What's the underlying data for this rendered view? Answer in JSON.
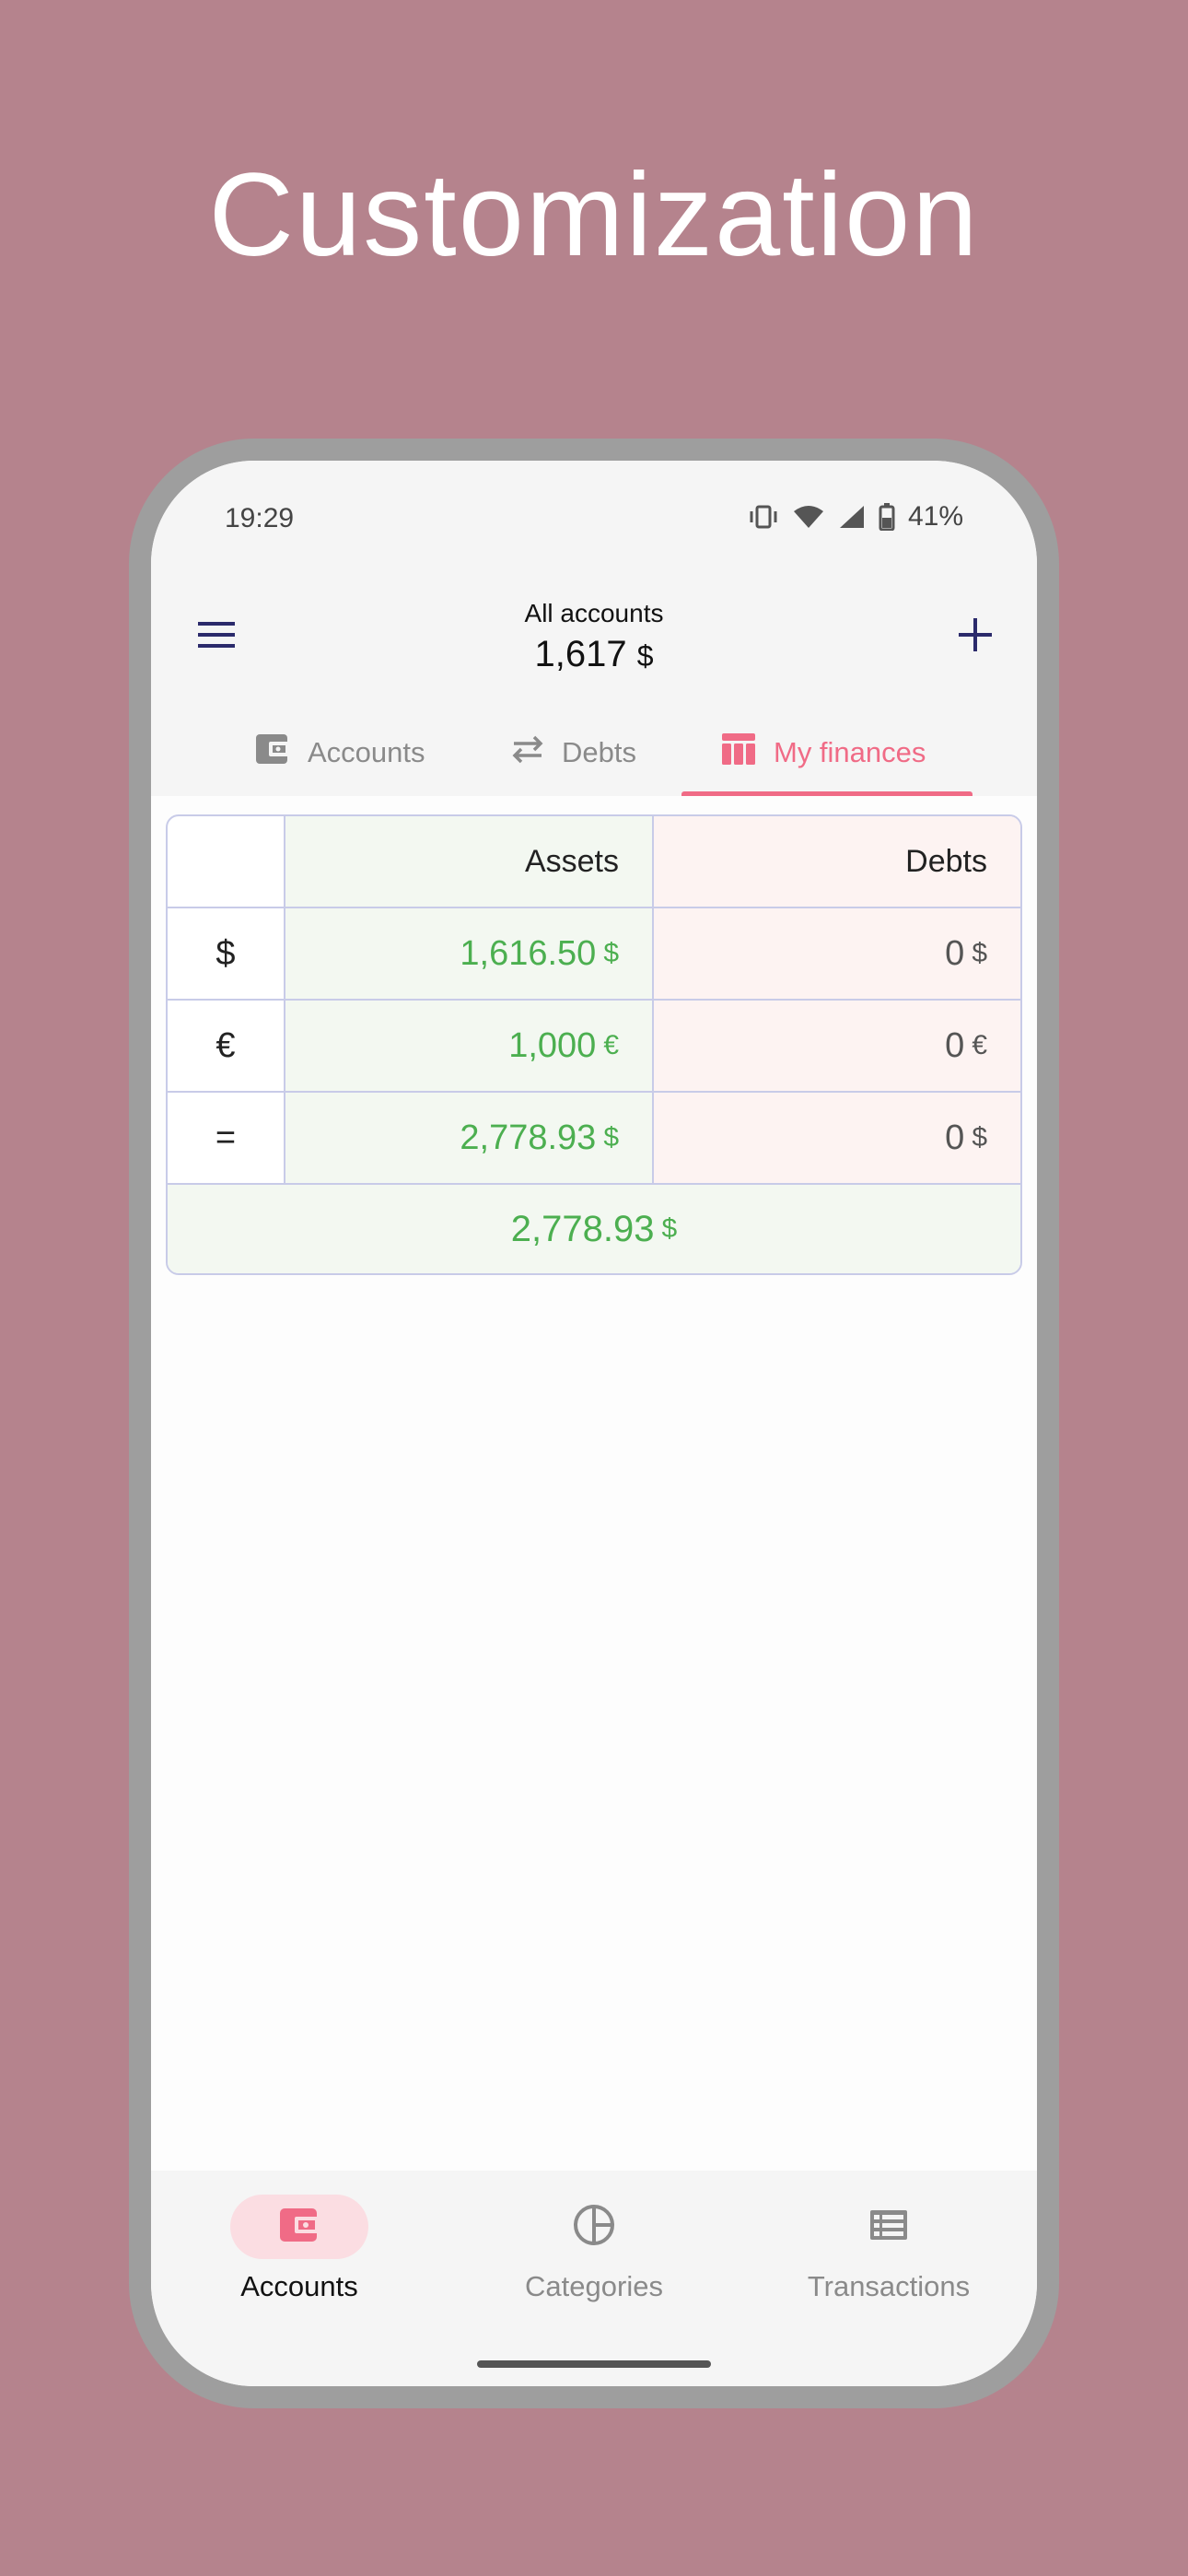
{
  "promo": {
    "title": "Customization"
  },
  "status_bar": {
    "time": "19:29",
    "battery": "41%"
  },
  "app_bar": {
    "title": "All accounts",
    "amount": "1,617",
    "currency": "$"
  },
  "tabs": [
    {
      "label": "Accounts",
      "icon": "wallet-icon",
      "active": false
    },
    {
      "label": "Debts",
      "icon": "swap-arrows-icon",
      "active": false
    },
    {
      "label": "My finances",
      "icon": "table-icon",
      "active": true
    }
  ],
  "finances_table": {
    "headers": [
      "",
      "Assets",
      "Debts"
    ],
    "rows": [
      {
        "currency": "$",
        "assets": "1,616.50",
        "assets_cur": "$",
        "debts": "0",
        "debts_cur": "$"
      },
      {
        "currency": "€",
        "assets": "1,000",
        "assets_cur": "€",
        "debts": "0",
        "debts_cur": "€"
      },
      {
        "currency": "=",
        "assets": "2,778.93",
        "assets_cur": "$",
        "debts": "0",
        "debts_cur": "$"
      }
    ],
    "total": "2,778.93",
    "total_cur": "$"
  },
  "bottom_nav": [
    {
      "label": "Accounts",
      "icon": "wallet-icon",
      "active": true
    },
    {
      "label": "Categories",
      "icon": "pie-chart-icon",
      "active": false
    },
    {
      "label": "Transactions",
      "icon": "list-icon",
      "active": false
    }
  ],
  "colors": {
    "background": "#b5838d",
    "accent": "#f06b86",
    "positive": "#4caf50",
    "app_bar_icons": "#2b2a6b"
  }
}
